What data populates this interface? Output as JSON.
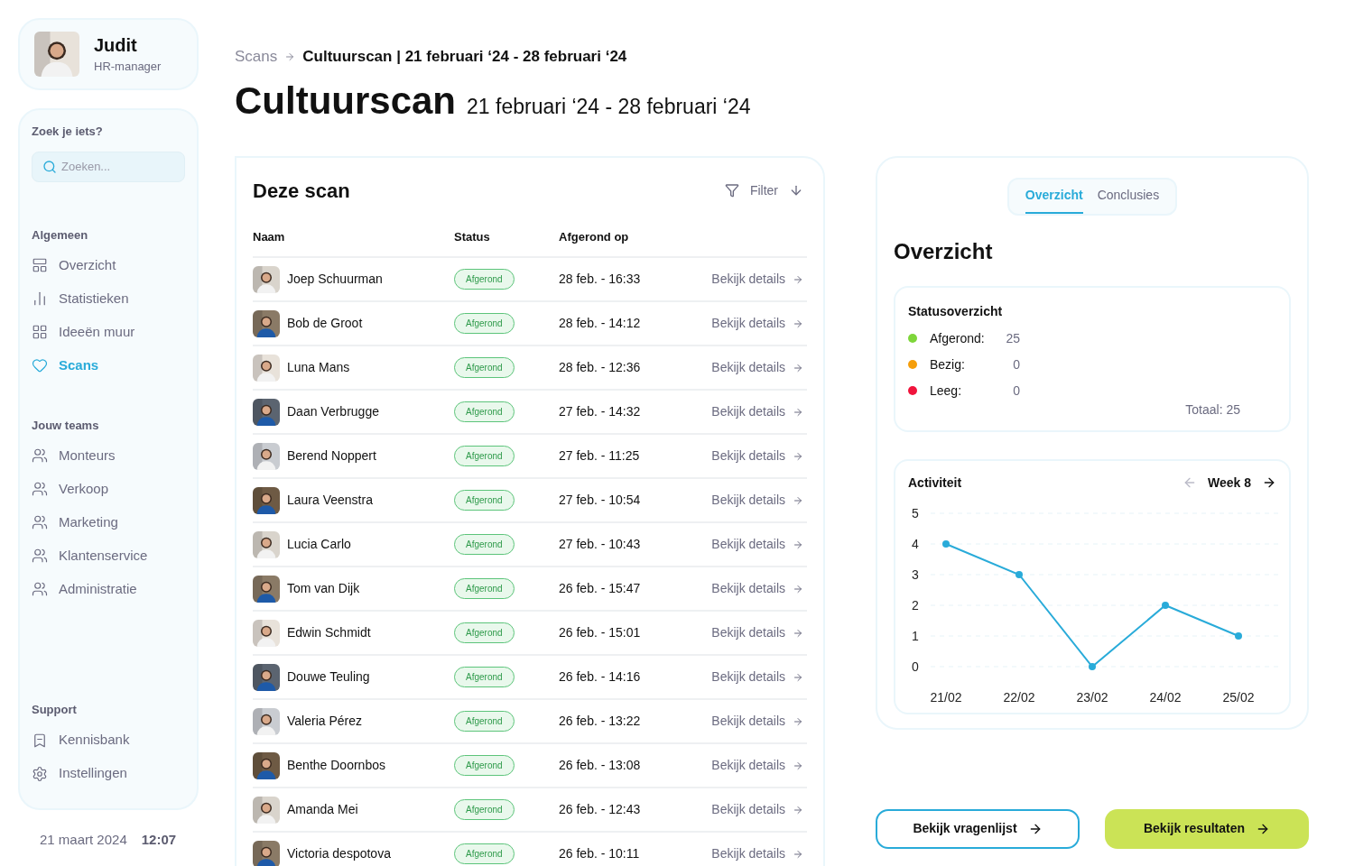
{
  "user": {
    "name": "Judit",
    "role": "HR-manager"
  },
  "search": {
    "label": "Zoek je iets?",
    "placeholder": "Zoeken..."
  },
  "nav_sections": [
    {
      "title": "Algemeen",
      "items": [
        {
          "label": "Overzicht",
          "selected": false
        },
        {
          "label": "Statistieken",
          "selected": false
        },
        {
          "label": "Ideeën muur",
          "selected": false
        },
        {
          "label": "Scans",
          "selected": true
        }
      ]
    },
    {
      "title": "Jouw teams",
      "items": [
        {
          "label": "Monteurs",
          "selected": false
        },
        {
          "label": "Verkoop",
          "selected": false
        },
        {
          "label": "Marketing",
          "selected": false
        },
        {
          "label": "Klantenservice",
          "selected": false
        },
        {
          "label": "Administratie",
          "selected": false
        }
      ]
    },
    {
      "title": "Support",
      "items": [
        {
          "label": "Kennisbank",
          "selected": false
        },
        {
          "label": "Instellingen",
          "selected": false
        }
      ]
    }
  ],
  "footer": {
    "date": "21 maart 2024",
    "time": "12:07"
  },
  "breadcrumb": [
    "Scans",
    "Cultuurscan | 21 februari ‘24 - 28 februari ‘24"
  ],
  "page_title": "Cultuurscan",
  "page_subtitle": "21 februari ‘24 - 28 februari ‘24",
  "table": {
    "title": "Deze scan",
    "filter": "Filter",
    "columns": [
      "Naam",
      "Status",
      "Afgerond op"
    ],
    "rows": [
      {
        "name": "Joep Schuurman",
        "status": "Afgerond",
        "date": "28 feb. - 16:33",
        "action": "Bekijk details"
      },
      {
        "name": "Bob de Groot",
        "status": "Afgerond",
        "date": "28 feb. - 14:12",
        "action": "Bekijk details"
      },
      {
        "name": "Luna Mans",
        "status": "Afgerond",
        "date": "28 feb. - 12:36",
        "action": "Bekijk details"
      },
      {
        "name": "Daan Verbrugge",
        "status": "Afgerond",
        "date": "27 feb. - 14:32",
        "action": "Bekijk details"
      },
      {
        "name": "Berend Noppert",
        "status": "Afgerond",
        "date": "27 feb. - 11:25",
        "action": "Bekijk details"
      },
      {
        "name": "Laura Veenstra",
        "status": "Afgerond",
        "date": "27 feb. - 10:54",
        "action": "Bekijk details"
      },
      {
        "name": "Lucia Carlo",
        "status": "Afgerond",
        "date": "27 feb. - 10:43",
        "action": "Bekijk details"
      },
      {
        "name": "Tom van Dijk",
        "status": "Afgerond",
        "date": "26 feb. - 15:47",
        "action": "Bekijk details"
      },
      {
        "name": "Edwin Schmidt",
        "status": "Afgerond",
        "date": "26 feb. - 15:01",
        "action": "Bekijk details"
      },
      {
        "name": "Douwe Teuling",
        "status": "Afgerond",
        "date": "26 feb. - 14:16",
        "action": "Bekijk details"
      },
      {
        "name": "Valeria Pérez",
        "status": "Afgerond",
        "date": "26 feb. - 13:22",
        "action": "Bekijk details"
      },
      {
        "name": "Benthe Doornbos",
        "status": "Afgerond",
        "date": "26 feb. - 13:08",
        "action": "Bekijk details"
      },
      {
        "name": "Amanda Mei",
        "status": "Afgerond",
        "date": "26 feb. - 12:43",
        "action": "Bekijk details"
      },
      {
        "name": "Victoria despotova",
        "status": "Afgerond",
        "date": "26 feb. - 10:11",
        "action": "Bekijk details"
      }
    ]
  },
  "tabs": [
    {
      "label": "Overzicht",
      "selected": true
    },
    {
      "label": "Conclusies",
      "selected": false
    }
  ],
  "overview_title": "Overzicht",
  "status_overview": {
    "title": "Statusoverzicht",
    "items": [
      {
        "label": "Afgerond:",
        "count": "25",
        "color": "#7ed63a"
      },
      {
        "label": "Bezig:",
        "count": "0",
        "color": "#f59e0b"
      },
      {
        "label": "Leeg:",
        "count": "0",
        "color": "#f0143c"
      }
    ],
    "total": "Totaal: 25"
  },
  "activity": {
    "title": "Activiteit",
    "week": "Week 8",
    "chart_data": {
      "type": "line",
      "categories": [
        "21/02",
        "22/02",
        "23/02",
        "24/02",
        "25/02"
      ],
      "series": [
        {
          "color": "#29abd9",
          "values": [
            4,
            3,
            0,
            2,
            1
          ],
          "marker": true
        }
      ],
      "grid": true,
      "ylim": [
        0,
        5
      ],
      "yticks": [
        0,
        1,
        2,
        3,
        4,
        5
      ]
    }
  },
  "buttons": [
    {
      "label": "Bekijk vragenlijst",
      "kind": "outline"
    },
    {
      "label": "Bekijk resultaten",
      "kind": "filled"
    }
  ]
}
